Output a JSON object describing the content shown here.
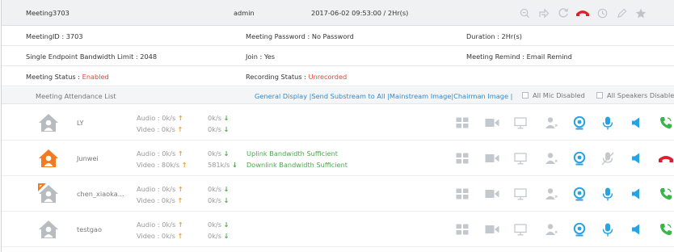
{
  "title_bar": {
    "meeting_name": "Meeting3703",
    "admin": "admin",
    "time": "2017-06-02 09:53:00 / 2Hr(s)",
    "icons": [
      "zoom-out-icon",
      "share-icon",
      "refresh-icon",
      "hangup-all-icon",
      "clock-icon",
      "edit-icon",
      "star-icon"
    ]
  },
  "info": {
    "meeting_id": "MeetingID : 3703",
    "password": "Meeting Password : No Password",
    "duration": "Duration :  2Hr(s)",
    "bandwidth_limit": "Single Endpoint Bandwidth Limit : 2048",
    "join": "Join : Yes",
    "remind": "Meeting Remind : Email Remind",
    "status_label": "Meeting Status : ",
    "status_value": "Enabled",
    "recording_label": "Recording Status : ",
    "recording_value": "Unrecorded"
  },
  "list_header": {
    "title": "Meeting Attendance List",
    "general_display": "General Display",
    "send_substream": "Send Substream to All",
    "mainstream_image": "Mainstream Image",
    "chairman_image": "Chairman Image",
    "sep": "|",
    "all_mic_disabled": "All Mic Disabled",
    "all_speakers_disabled": "All Speakers Disabled"
  },
  "participants": [
    {
      "name": "LY",
      "avatar": "gray",
      "audio": "Audio : 0k/s",
      "video": "Video : 0k/s",
      "audio_in": "0k/s",
      "video_in": "0k/s",
      "uplink": "",
      "downlink": "",
      "call": "green"
    },
    {
      "name": "Junwei",
      "avatar": "orange",
      "audio": "Audio : 0k/s",
      "video": "Video : 80k/s",
      "audio_in": "0k/s",
      "video_in": "581k/s",
      "uplink": "Uplink Bandwidth Sufficient",
      "downlink": "Downlink Bandwidth Sufficient",
      "call": "red"
    },
    {
      "name": "chen_xiaoka...",
      "avatar": "gray-flag",
      "audio": "Audio : 0k/s",
      "video": "Video : 0k/s",
      "audio_in": "0k/s",
      "video_in": "0k/s",
      "uplink": "",
      "downlink": "",
      "call": "green"
    },
    {
      "name": "testgao",
      "avatar": "gray",
      "audio": "Audio : 0k/s",
      "video": "Video : 0k/s",
      "audio_in": "0k/s",
      "video_in": "0k/s",
      "uplink": "",
      "downlink": "",
      "call": "green"
    }
  ],
  "arrows": {
    "up": "↑",
    "down": "↓"
  },
  "colors": {
    "accent_blue": "#2f8ad1",
    "status_red": "#e0453a",
    "ok_green": "#4aa94a",
    "upload_orange": "#f0a020",
    "avatar_orange": "#f47a20",
    "icon_gray": "#bfc4ca"
  }
}
